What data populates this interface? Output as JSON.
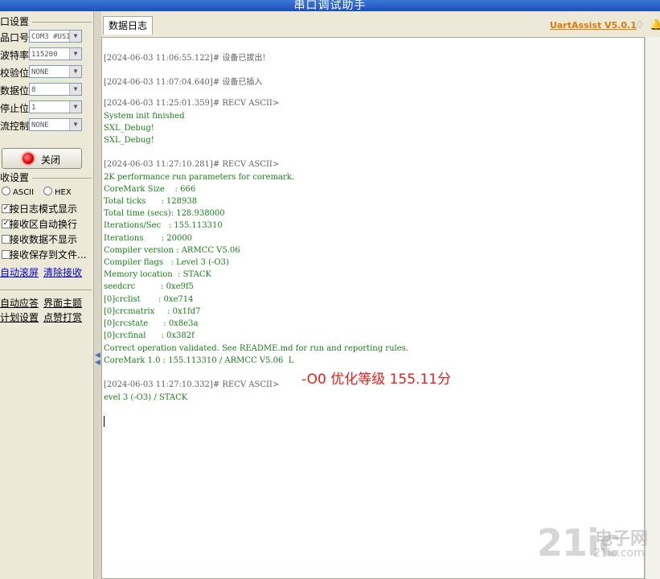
{
  "window": {
    "title": "串口调试助手"
  },
  "left_panel": {
    "serial_settings_title": "口设置",
    "fields": [
      {
        "label": "品口号",
        "value": "COM3 #USI"
      },
      {
        "label": "波特率",
        "value": "115200"
      },
      {
        "label": "校验位",
        "value": "NONE"
      },
      {
        "label": "数据位",
        "value": "8"
      },
      {
        "label": "停止位",
        "value": "1"
      },
      {
        "label": "流控制",
        "value": "NONE"
      }
    ],
    "close_button": "关闭",
    "recv_settings_title": "收设置",
    "radio_ascii": "ASCII",
    "radio_hex": "HEX",
    "checkboxes": [
      {
        "label": "按日志模式显示",
        "checked": "✓"
      },
      {
        "label": "接收区自动换行",
        "checked": "✓"
      },
      {
        "label": "接收数据不显示",
        "checked": ""
      },
      {
        "label": "接收保存到文件...",
        "checked": ""
      }
    ],
    "auto_scroll": "自动滚屏",
    "clear_recv": "清除接收",
    "auto_reply": "自动应答",
    "ui_theme": "界面主题",
    "plugin_settings": "计划设置",
    "tips": "点赞打赏"
  },
  "tab": {
    "label": "数据日志"
  },
  "brand": {
    "label": "UartAssist V5.0.1"
  },
  "log": [
    {
      "kind": "ts",
      "text": "[2024-06-03 11:06:55.122]# 设备已拔出!"
    },
    {
      "kind": "ts",
      "text": "[2024-06-03 11:07:04.640]# 设备已插入"
    },
    {
      "kind": "ts",
      "text": "[2024-06-03 11:25:01.359]# RECV ASCII>"
    },
    {
      "kind": "rx",
      "text": "System init finished"
    },
    {
      "kind": "rx",
      "text": "SXL_Debug!"
    },
    {
      "kind": "rx",
      "text": "SXL_Debug!"
    },
    {
      "kind": "ts",
      "text": "[2024-06-03 11:27:10.281]# RECV ASCII>"
    },
    {
      "kind": "rx",
      "text": "2K performance run parameters for coremark."
    },
    {
      "kind": "rx",
      "text": "CoreMark Size    : 666"
    },
    {
      "kind": "rx",
      "text": "Total ticks      : 128938"
    },
    {
      "kind": "rx",
      "text": "Total time (secs): 128.938000"
    },
    {
      "kind": "rx",
      "text": "Iterations/Sec   : 155.113310"
    },
    {
      "kind": "rx",
      "text": "Iterations       : 20000"
    },
    {
      "kind": "rx",
      "text": "Compiler version : ARMCC V5.06"
    },
    {
      "kind": "rx",
      "text": "Compiler flags   : Level 3 (-O3)"
    },
    {
      "kind": "rx",
      "text": "Memory location  : STACK"
    },
    {
      "kind": "rx",
      "text": "seedcrc          : 0xe9f5"
    },
    {
      "kind": "rx",
      "text": "[0]crclist       : 0xe714"
    },
    {
      "kind": "rx",
      "text": "[0]crcmatrix     : 0x1fd7"
    },
    {
      "kind": "rx",
      "text": "[0]crcstate      : 0x8e3a"
    },
    {
      "kind": "rx",
      "text": "[0]crcfinal      : 0x382f"
    },
    {
      "kind": "rx",
      "text": "Correct operation validated. See README.md for run and reporting rules."
    },
    {
      "kind": "rx",
      "text": "CoreMark 1.0 : 155.113310 / ARMCC V5.06  L"
    },
    {
      "kind": "ts",
      "text": "[2024-06-03 11:27:10.332]# RECV ASCII>"
    },
    {
      "kind": "rx",
      "text": "evel 3 (-O3) / STACK"
    }
  ],
  "annotation": "-O0 优化等级 155.11分",
  "watermark": {
    "main": "21ic",
    "cn": "电子网",
    "domain": "21ic.com"
  }
}
